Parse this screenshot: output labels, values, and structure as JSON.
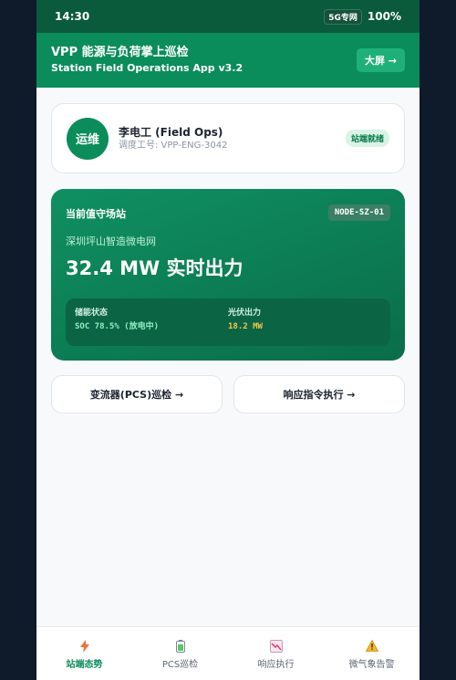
{
  "status_bar": {
    "time": "14:30",
    "network": "5G专网",
    "battery": "100%"
  },
  "app_bar": {
    "title": "VPP 能源与负荷掌上巡检",
    "subtitle": "Station Field Operations App v3.2",
    "bigscreen_label": "大屏 →"
  },
  "user": {
    "avatar_text": "运维",
    "name": "李电工 (Field Ops)",
    "id_label": "调度工号: VPP-ENG-3042",
    "status": "站端就绪"
  },
  "station": {
    "heading": "当前值守场站",
    "node_id": "NODE-SZ-01",
    "name": "深圳坪山智造微电网",
    "power": "32.4 MW 实时出力",
    "metrics": [
      {
        "label": "储能状态",
        "value": "SOC 78.5% (放电中)"
      },
      {
        "label": "光伏出力",
        "value": "18.2 MW"
      }
    ]
  },
  "actions": {
    "pcs_label": "变流器(PCS)巡检 →",
    "exec_label": "响应指令执行 →"
  },
  "tabs": [
    {
      "label": "站端态势",
      "icon": "lightning-icon",
      "active": true
    },
    {
      "label": "PCS巡检",
      "icon": "battery-icon",
      "active": false
    },
    {
      "label": "响应执行",
      "icon": "trend-chart-icon",
      "active": false
    },
    {
      "label": "微气象告警",
      "icon": "warning-icon",
      "active": false
    }
  ],
  "colors": {
    "primary": "#0b8c5b",
    "accent_yellow": "#f5c84a",
    "background": "#0f1a2b"
  }
}
